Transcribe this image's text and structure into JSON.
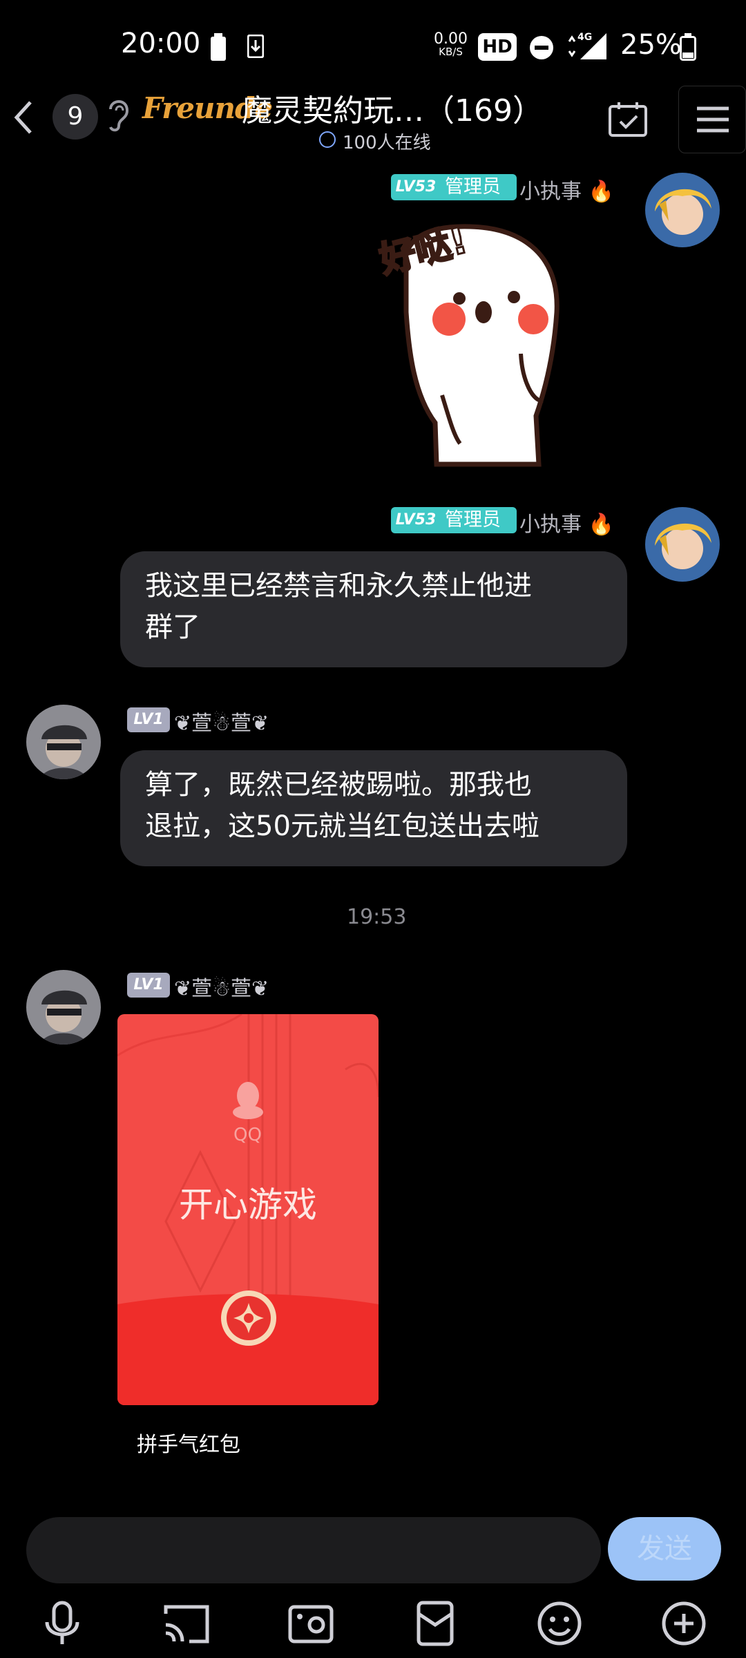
{
  "status_bar": {
    "time": "20:00",
    "net_speed_value": "0.00",
    "net_speed_unit": "KB/S",
    "hd_badge": "HD",
    "network_type": "4G",
    "battery_percent": "25%"
  },
  "header": {
    "unread_count": "9",
    "brand_logo_text": "Freunde",
    "group_title": "魔灵契約玩…（169）",
    "online_text": "100人在线"
  },
  "messages": [
    {
      "sender_level": "LV53",
      "sender_role": "管理员",
      "sender_name": "小执事 🔥",
      "type": "sticker",
      "sticker_text": "好哒!"
    },
    {
      "sender_level": "LV53",
      "sender_role": "管理员",
      "sender_name": "小执事 🔥",
      "type": "text",
      "line1": "我这里已经禁言和永久禁止他进",
      "line2": "群了"
    },
    {
      "sender_level": "LV1",
      "sender_name": "❦萱☃萱❦",
      "type": "text",
      "line1": "算了，既然已经被踢啦。那我也",
      "line2": "退拉，这50元就当红包送出去啦"
    }
  ],
  "timestamp": "19:53",
  "red_packet_message": {
    "sender_level": "LV1",
    "sender_name": "❦萱☃萱❦",
    "brand": "QQ",
    "greeting": "开心游戏",
    "packet_type": "拼手气红包"
  },
  "input_bar": {
    "placeholder": "",
    "send_label": "发送"
  },
  "colors": {
    "background": "#000000",
    "bubble": "#2a2a2e",
    "admin_tag": "#3fc9c6",
    "lv1_tag": "#a7a9bd",
    "red_packet": "#f34b47",
    "send_button": "#9cc3f7"
  },
  "toolbar_icons": [
    "microphone-icon",
    "cast-icon",
    "camera-icon",
    "red-packet-icon",
    "emoji-icon",
    "plus-icon"
  ]
}
